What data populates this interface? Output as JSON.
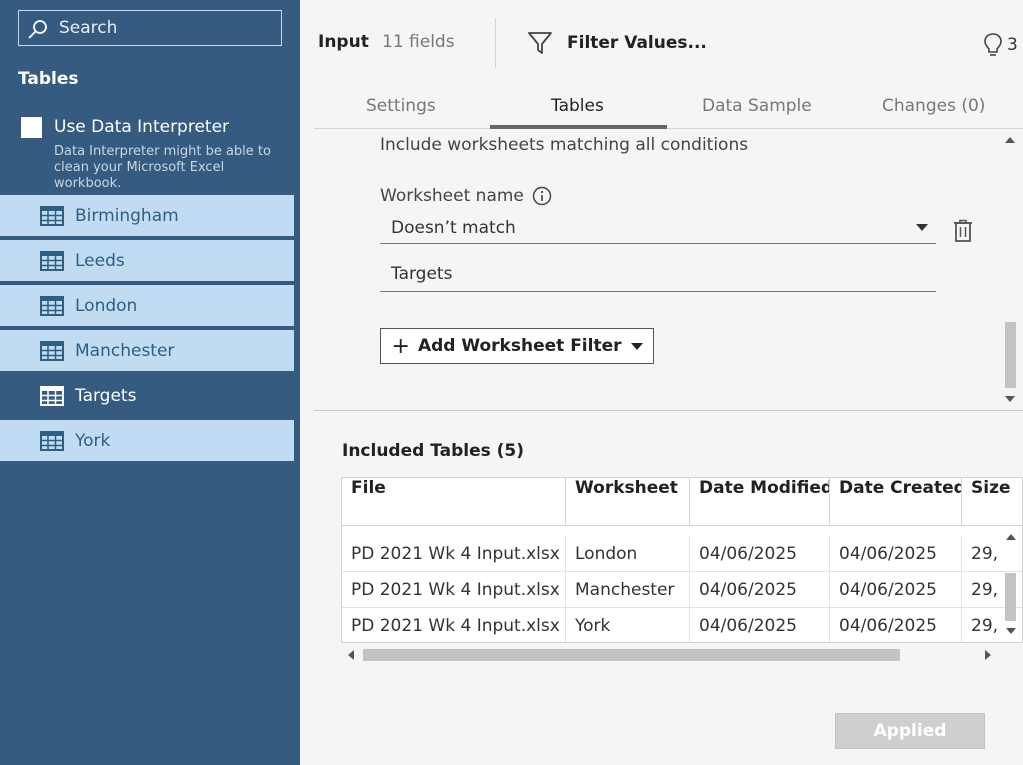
{
  "sidebar": {
    "search_placeholder": "Search",
    "tables_heading": "Tables",
    "interpreter": {
      "label": "Use Data Interpreter",
      "checked": false,
      "description": "Data Interpreter might be able to clean your Microsoft Excel workbook."
    },
    "items": [
      {
        "label": "Birmingham",
        "selected": true
      },
      {
        "label": "Leeds",
        "selected": true
      },
      {
        "label": "London",
        "selected": true
      },
      {
        "label": "Manchester",
        "selected": true
      },
      {
        "label": "Targets",
        "selected": false
      },
      {
        "label": "York",
        "selected": true
      }
    ]
  },
  "toolbar": {
    "title": "Input",
    "fields": "11 fields",
    "filter_label": "Filter Values...",
    "bulb_count": "3"
  },
  "tabs": [
    {
      "label": "Settings",
      "active": false
    },
    {
      "label": "Tables",
      "active": true
    },
    {
      "label": "Data Sample",
      "active": false
    },
    {
      "label": "Changes (0)",
      "active": false
    }
  ],
  "filter": {
    "include_text": "Include worksheets matching all conditions",
    "worksheet_label": "Worksheet name",
    "condition": "Doesn’t match",
    "value": "Targets",
    "add_button": "Add Worksheet Filter"
  },
  "included": {
    "heading": "Included Tables (5)",
    "columns": [
      "File",
      "Worksheet",
      "Date Modified",
      "Date Created",
      "Size"
    ],
    "rows": [
      [
        "PD 2021 Wk 4 Input.xlsx",
        "London",
        "04/06/2025",
        "04/06/2025",
        "29,"
      ],
      [
        "PD 2021 Wk 4 Input.xlsx",
        "Manchester",
        "04/06/2025",
        "04/06/2025",
        "29,"
      ],
      [
        "PD 2021 Wk 4 Input.xlsx",
        "York",
        "04/06/2025",
        "04/06/2025",
        "29,"
      ]
    ]
  },
  "applied_button": "Applied",
  "colors": {
    "sidebar_bg": "#355b80",
    "selected_item_bg": "#c1dcf1",
    "selected_item_text": "#2d5f86"
  }
}
